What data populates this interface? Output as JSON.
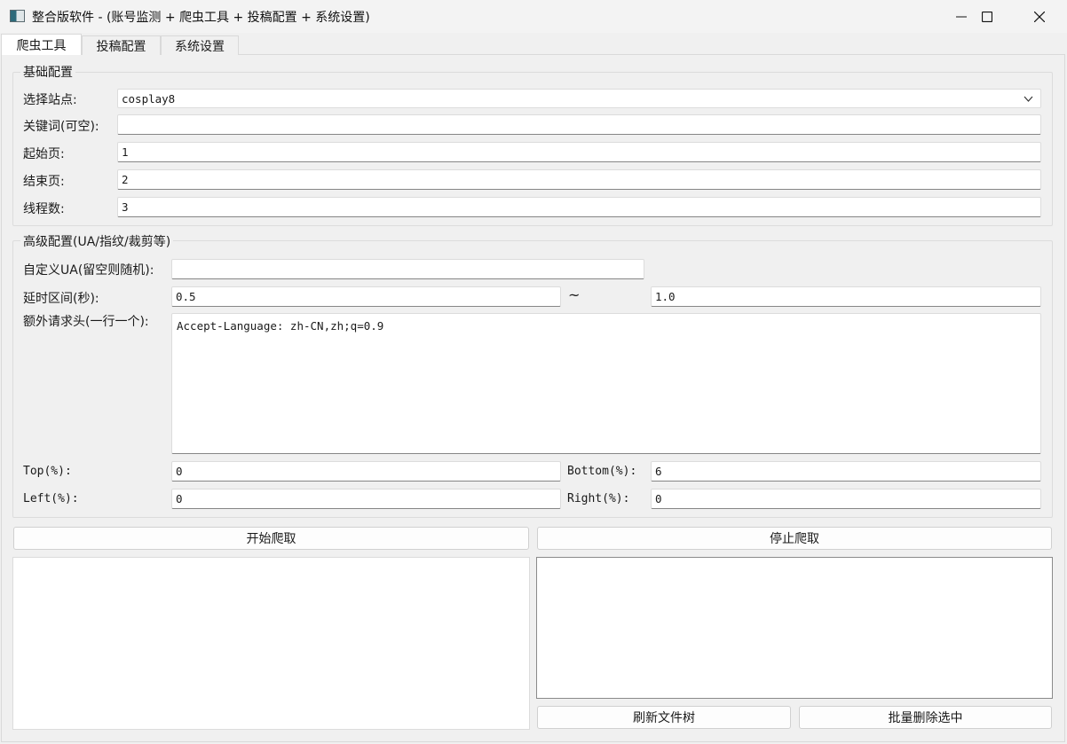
{
  "window": {
    "title": "整合版软件 - (账号监测 + 爬虫工具 + 投稿配置 + 系统设置)",
    "icon": "app-window-icon",
    "controls": [
      "minimize-icon",
      "maximize-icon",
      "close-icon"
    ]
  },
  "tabs": [
    {
      "label": "爬虫工具",
      "active": true
    },
    {
      "label": "投稿配置",
      "active": false
    },
    {
      "label": "系统设置",
      "active": false
    }
  ],
  "basic": {
    "title": "基础配置",
    "site_label": "选择站点:",
    "site_value": "cosplay8",
    "keyword_label": "关键词(可空):",
    "keyword_value": "",
    "start_label": "起始页:",
    "start_value": "1",
    "end_label": "结束页:",
    "end_value": "2",
    "threads_label": "线程数:",
    "threads_value": "3"
  },
  "advanced": {
    "title": "高级配置(UA/指纹/裁剪等)",
    "ua_label": "自定义UA(留空则随机):",
    "ua_value": "",
    "delay_label": "延时区间(秒):",
    "delay_min": "0.5",
    "delay_sep": "~",
    "delay_max": "1.0",
    "headers_label": "额外请求头(一行一个):",
    "headers_value": "Accept-Language: zh-CN,zh;q=0.9",
    "top_label": "Top(%):",
    "top_value": "0",
    "bottom_label": "Bottom(%):",
    "bottom_value": "6",
    "left_label": "Left(%):",
    "left_value": "0",
    "right_label": "Right(%):",
    "right_value": "0"
  },
  "actions": {
    "start": "开始爬取",
    "stop": "停止爬取",
    "refresh_tree": "刷新文件树",
    "batch_delete": "批量删除选中"
  }
}
